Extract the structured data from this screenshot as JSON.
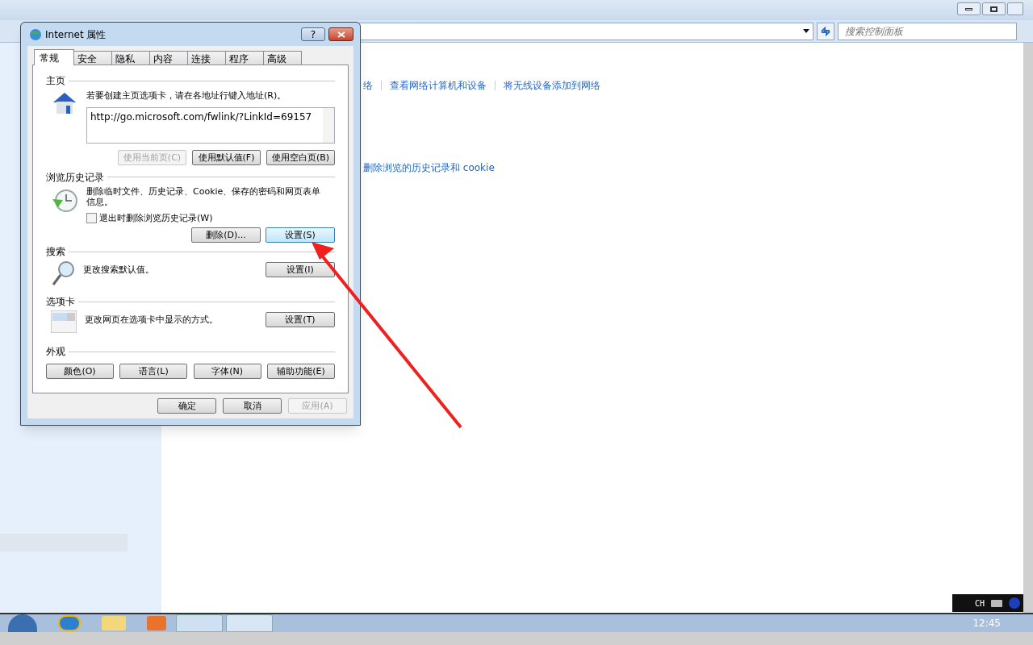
{
  "window": {
    "search": {
      "placeholder": "搜索控制面板"
    },
    "links": [
      "络",
      "查看网络计算机和设备",
      "将无线设备添加到网络"
    ],
    "history_link": "删除浏览的历史记录和 cookie"
  },
  "dialog": {
    "title": "Internet 属性",
    "help": "?",
    "tabs": [
      {
        "label": "常规",
        "selected": true
      },
      {
        "label": "安全",
        "selected": false
      },
      {
        "label": "隐私",
        "selected": false
      },
      {
        "label": "内容",
        "selected": false
      },
      {
        "label": "连接",
        "selected": false
      },
      {
        "label": "程序",
        "selected": false
      },
      {
        "label": "高级",
        "selected": false
      }
    ],
    "homepage": {
      "label": "主页",
      "description": "若要创建主页选项卡，请在各地址行键入地址(R)。",
      "url": "http://go.microsoft.com/fwlink/?LinkId=69157",
      "buttons": [
        {
          "label": "使用当前页(C)",
          "disabled": true
        },
        {
          "label": "使用默认值(F)",
          "disabled": false
        },
        {
          "label": "使用空白页(B)",
          "disabled": false
        }
      ]
    },
    "history": {
      "label": "浏览历史记录",
      "description": "删除临时文件、历史记录、Cookie、保存的密码和网页表单信息。",
      "checkbox": {
        "label": "退出时删除浏览历史记录(W)",
        "checked": false
      },
      "buttons": [
        {
          "label": "删除(D)...",
          "focused": false
        },
        {
          "label": "设置(S)",
          "focused": true
        }
      ]
    },
    "search": {
      "label": "搜索",
      "description": "更改搜索默认值。",
      "button": "设置(I)"
    },
    "tabs_section": {
      "label": "选项卡",
      "description": "更改网页在选项卡中显示的方式。",
      "button": "设置(T)"
    },
    "appearance": {
      "label": "外观",
      "buttons": [
        "颜色(O)",
        "语言(L)",
        "字体(N)",
        "辅助功能(E)"
      ]
    },
    "footer": [
      {
        "label": "确定",
        "disabled": false
      },
      {
        "label": "取消",
        "disabled": false
      },
      {
        "label": "应用(A)",
        "disabled": true
      }
    ]
  },
  "language_bar": {
    "language": "CH"
  },
  "taskbar": {
    "clock": "12:45"
  }
}
